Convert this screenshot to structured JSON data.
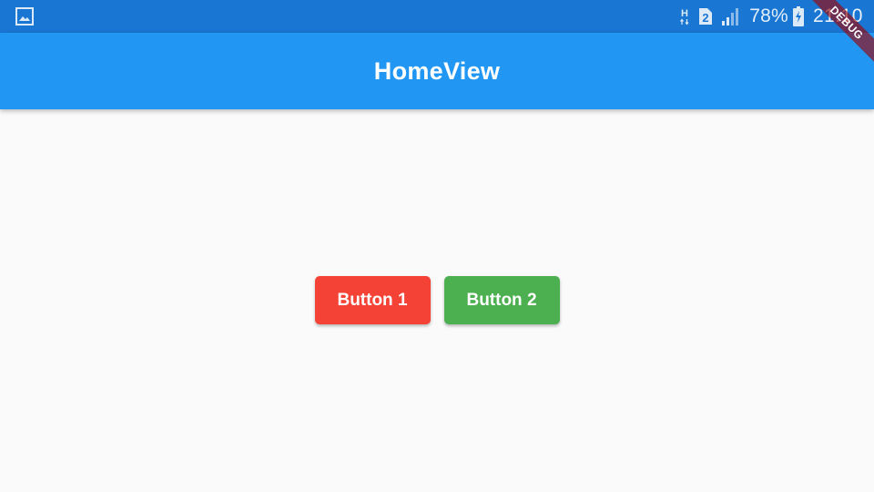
{
  "status_bar": {
    "left_icon": "gallery-notification-icon",
    "network_type": "H",
    "sim_slot": "2",
    "signal_icon": "cellular-signal-icon",
    "battery_percent": "78%",
    "battery_icon": "battery-charging-icon",
    "time": "21:10"
  },
  "app_bar": {
    "title": "HomeView"
  },
  "buttons": {
    "button1_label": "Button 1",
    "button2_label": "Button 2"
  },
  "debug_banner": {
    "label": "DEBUG"
  },
  "colors": {
    "status_bar": "#1976d2",
    "app_bar": "#2196f3",
    "background": "#fafafa",
    "button1": "#f44336",
    "button2": "#4caf50"
  }
}
